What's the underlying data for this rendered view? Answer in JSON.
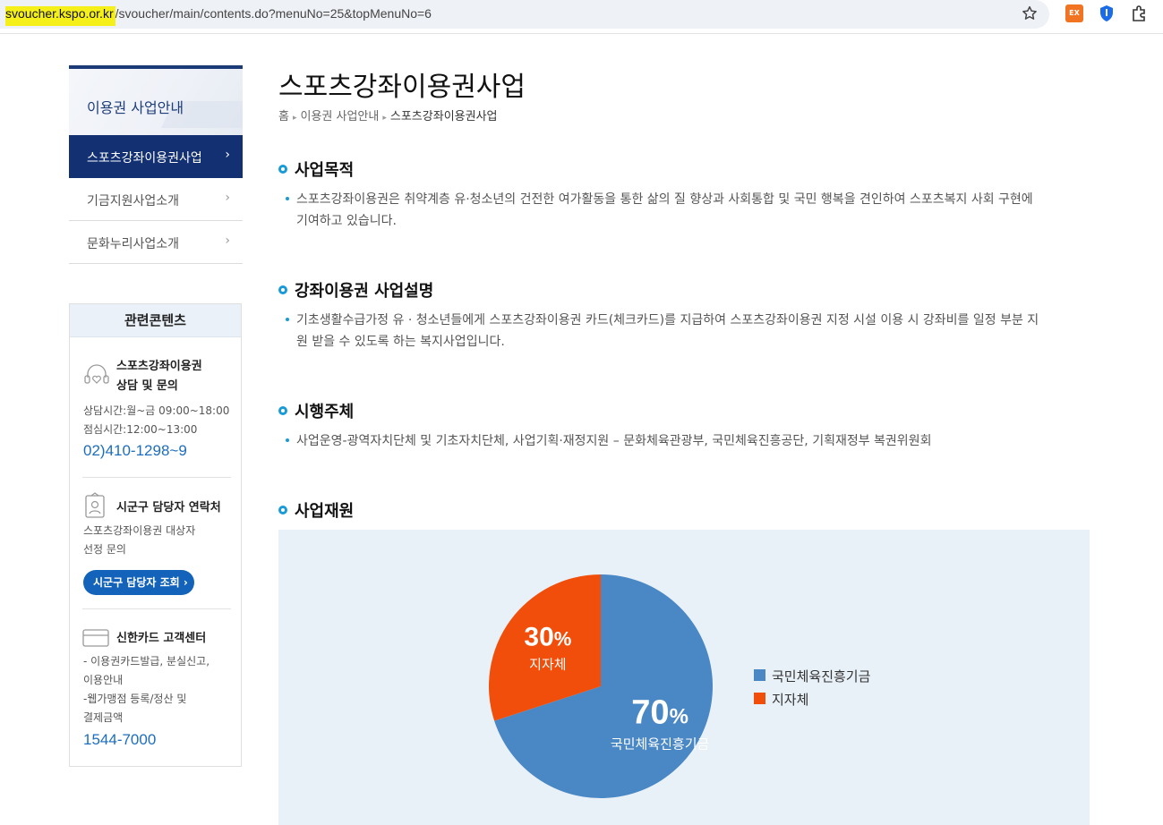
{
  "browser": {
    "url_host": "svoucher.kspo.or.kr",
    "url_path": "/svoucher/main/contents.do?menuNo=25&topMenuNo=6",
    "ext_label": "EX"
  },
  "sidebar": {
    "title": "이용권 사업안내",
    "items": [
      {
        "label": "스포츠강좌이용권사업",
        "active": true
      },
      {
        "label": "기금지원사업소개",
        "active": false
      },
      {
        "label": "문화누리사업소개",
        "active": false
      }
    ]
  },
  "related": {
    "title": "관련콘텐츠",
    "consult": {
      "title_line1": "스포츠강좌이용권",
      "title_line2": "상담 및 문의",
      "hours": "상담시간:월~금 09:00~18:00",
      "lunch": "점심시간:12:00~13:00",
      "phone": "02)410-1298~9"
    },
    "contact": {
      "title": "시군구 담당자 연락처",
      "line1": "스포츠강좌이용권 대상자",
      "line2": "선정 문의",
      "button": "시군구 담당자 조회 ›"
    },
    "card": {
      "title": "신한카드 고객센터",
      "line1": "- 이용권카드발급, 분실신고,",
      "line2": "이용안내",
      "line3": "-웹가맹점 등록/정산 및",
      "line4": "결제금액",
      "phone": "1544-7000"
    }
  },
  "main": {
    "title": "스포츠강좌이용권사업",
    "breadcrumb": {
      "home": "홈",
      "level1": "이용권 사업안내",
      "current": "스포츠강좌이용권사업"
    },
    "sections": [
      {
        "title": "사업목적",
        "line1": "스포츠강좌이용권은 취약계층 유·청소년의 건전한 여가활동을 통한 삶의 질 향상과 사회통합 및 국민 행복을 견인하여 스포츠복지 사회 구현에",
        "line2": "기여하고 있습니다."
      },
      {
        "title": "강좌이용권 사업설명",
        "line1": "기초생활수급가정 유 · 청소년들에게 스포츠강좌이용권 카드(체크카드)를 지급하여 스포츠강좌이용권 지정 시설 이용 시 강좌비를 일정 부분 지",
        "line2": "원 받을 수 있도록 하는 복지사업입니다."
      },
      {
        "title": "시행주체",
        "line1": "사업운영-광역자치단체 및 기초자치단체, 사업기획·재정지원 – 문화체육관광부, 국민체육진흥공단, 기획재정부 복권위원회"
      },
      {
        "title": "사업재원"
      }
    ]
  },
  "chart_data": {
    "type": "pie",
    "series": [
      {
        "name": "국민체육진흥기금",
        "value": 70,
        "color": "#4a87c5",
        "pct_num": "70",
        "pct_sym": "%"
      },
      {
        "name": "지자체",
        "value": 30,
        "color": "#f04e0a",
        "pct_num": "30",
        "pct_sym": "%"
      }
    ],
    "legend": [
      "국민체육진흥기금",
      "지자체"
    ],
    "legend_position": "right"
  }
}
